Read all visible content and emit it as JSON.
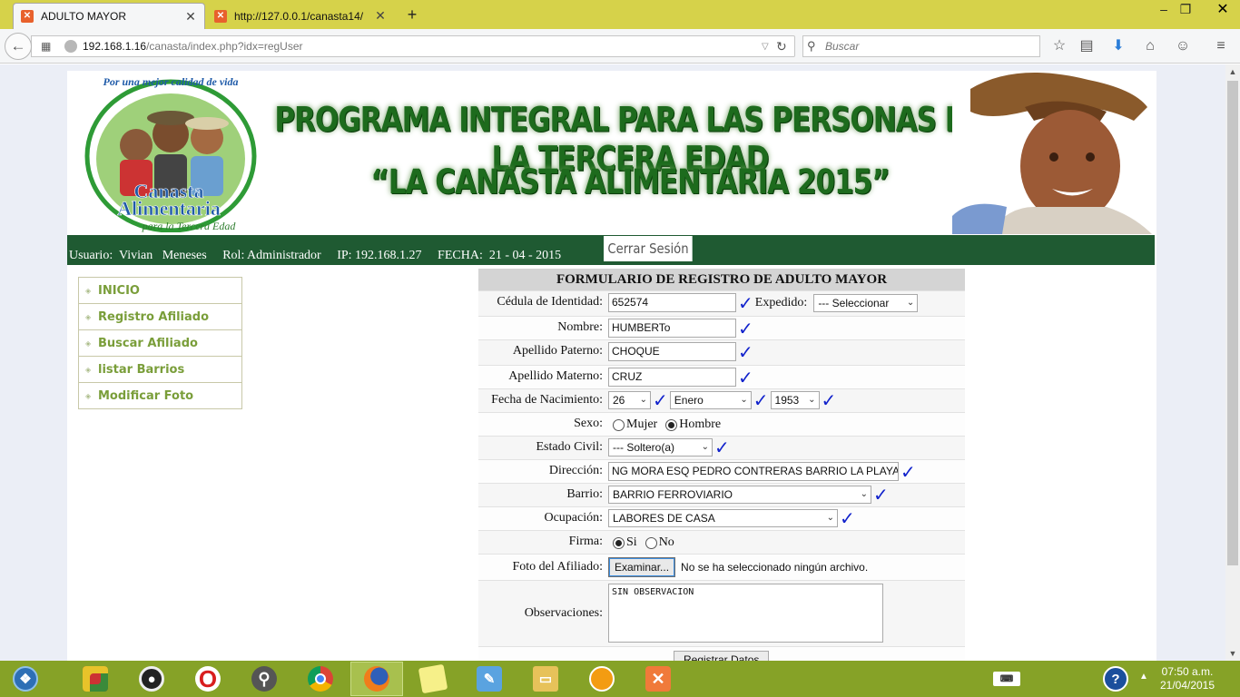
{
  "browser": {
    "tabs": [
      {
        "title": "ADULTO MAYOR",
        "active": true
      },
      {
        "title": "http://127.0.0.1/canasta14/",
        "active": false
      }
    ],
    "url_host": "192.168.1.16",
    "url_path": "/canasta/index.php?idx=regUser",
    "search_placeholder": "Buscar"
  },
  "banner": {
    "logo_text_top": "Por una mejor calidad de vida",
    "logo_text_main1": "Canasta",
    "logo_text_main2": "Alimentaria",
    "logo_text_sub": "para la Tercera Edad",
    "title": "PROGRAMA INTEGRAL PARA LAS PERSONAS DE LA TERCERA EDAD",
    "subtitle": "“LA CANASTA ALIMENTARIA 2015”"
  },
  "status": {
    "text": "Usuario:  Vivian   Meneses     Rol: Administrador     IP: 192.168.1.27     FECHA:  21 - 04 - 2015",
    "logout": "Cerrar Sesión"
  },
  "menu": [
    {
      "label": "INICIO"
    },
    {
      "label": "Registro Afiliado"
    },
    {
      "label": "Buscar Afiliado"
    },
    {
      "label": "listar Barrios"
    },
    {
      "label": "Modificar Foto"
    }
  ],
  "form": {
    "title": "FORMULARIO DE REGISTRO DE ADULTO MAYOR",
    "ci_label": "Cédula de Identidad:",
    "ci_value": "652574",
    "expedido_label": "Expedido:",
    "expedido_value": "--- Seleccionar",
    "nombre_label": "Nombre:",
    "nombre_value": "HUMBERTo",
    "paterno_label": "Apellido Paterno:",
    "paterno_value": "CHOQUE",
    "materno_label": "Apellido Materno:",
    "materno_value": "CRUZ",
    "nac_label": "Fecha de Nacimiento:",
    "nac_day": "26",
    "nac_month": "Enero",
    "nac_year": "1953",
    "sexo_label": "Sexo:",
    "sexo_mujer": "Mujer",
    "sexo_hombre": "Hombre",
    "civil_label": "Estado Civil:",
    "civil_value": "--- Soltero(a)",
    "dir_label": "Dirección:",
    "dir_value": "NG MORA ESQ PEDRO CONTRERAS BARRIO LA PLAYA",
    "barrio_label": "Barrio:",
    "barrio_value": "BARRIO FERROVIARIO",
    "ocup_label": "Ocupación:",
    "ocup_value": "LABORES DE CASA",
    "firma_label": "Firma:",
    "firma_si": "Si",
    "firma_no": "No",
    "foto_label": "Foto del Afiliado:",
    "foto_button": "Examinar...",
    "foto_note": "No se ha seleccionado ningún archivo.",
    "obs_label": "Observaciones:",
    "obs_value": "SIN OBSERVACION",
    "submit": "Registrar Datos"
  },
  "taskbar": {
    "time": "07:50 a.m.",
    "date": "21/04/2015"
  }
}
